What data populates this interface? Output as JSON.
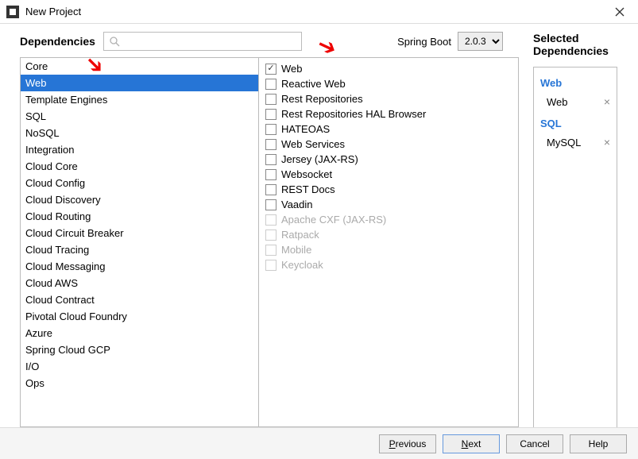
{
  "window": {
    "title": "New Project"
  },
  "header": {
    "dependencies_label": "Dependencies",
    "search_placeholder": "",
    "spring_boot_label": "Spring Boot",
    "spring_boot_version": "2.0.3"
  },
  "categories": [
    "Core",
    "Web",
    "Template Engines",
    "SQL",
    "NoSQL",
    "Integration",
    "Cloud Core",
    "Cloud Config",
    "Cloud Discovery",
    "Cloud Routing",
    "Cloud Circuit Breaker",
    "Cloud Tracing",
    "Cloud Messaging",
    "Cloud AWS",
    "Cloud Contract",
    "Pivotal Cloud Foundry",
    "Azure",
    "Spring Cloud GCP",
    "I/O",
    "Ops"
  ],
  "selected_category_index": 1,
  "options": [
    {
      "label": "Web",
      "checked": true,
      "disabled": false
    },
    {
      "label": "Reactive Web",
      "checked": false,
      "disabled": false
    },
    {
      "label": "Rest Repositories",
      "checked": false,
      "disabled": false
    },
    {
      "label": "Rest Repositories HAL Browser",
      "checked": false,
      "disabled": false
    },
    {
      "label": "HATEOAS",
      "checked": false,
      "disabled": false
    },
    {
      "label": "Web Services",
      "checked": false,
      "disabled": false
    },
    {
      "label": "Jersey (JAX-RS)",
      "checked": false,
      "disabled": false
    },
    {
      "label": "Websocket",
      "checked": false,
      "disabled": false
    },
    {
      "label": "REST Docs",
      "checked": false,
      "disabled": false
    },
    {
      "label": "Vaadin",
      "checked": false,
      "disabled": false
    },
    {
      "label": "Apache CXF (JAX-RS)",
      "checked": false,
      "disabled": true
    },
    {
      "label": "Ratpack",
      "checked": false,
      "disabled": true
    },
    {
      "label": "Mobile",
      "checked": false,
      "disabled": true
    },
    {
      "label": "Keycloak",
      "checked": false,
      "disabled": true
    }
  ],
  "selected_panel": {
    "title": "Selected Dependencies",
    "groups": [
      {
        "name": "Web",
        "items": [
          "Web"
        ]
      },
      {
        "name": "SQL",
        "items": [
          "MySQL"
        ]
      }
    ]
  },
  "footer": {
    "previous": "Previous",
    "next": "Next",
    "cancel": "Cancel",
    "help": "Help"
  }
}
